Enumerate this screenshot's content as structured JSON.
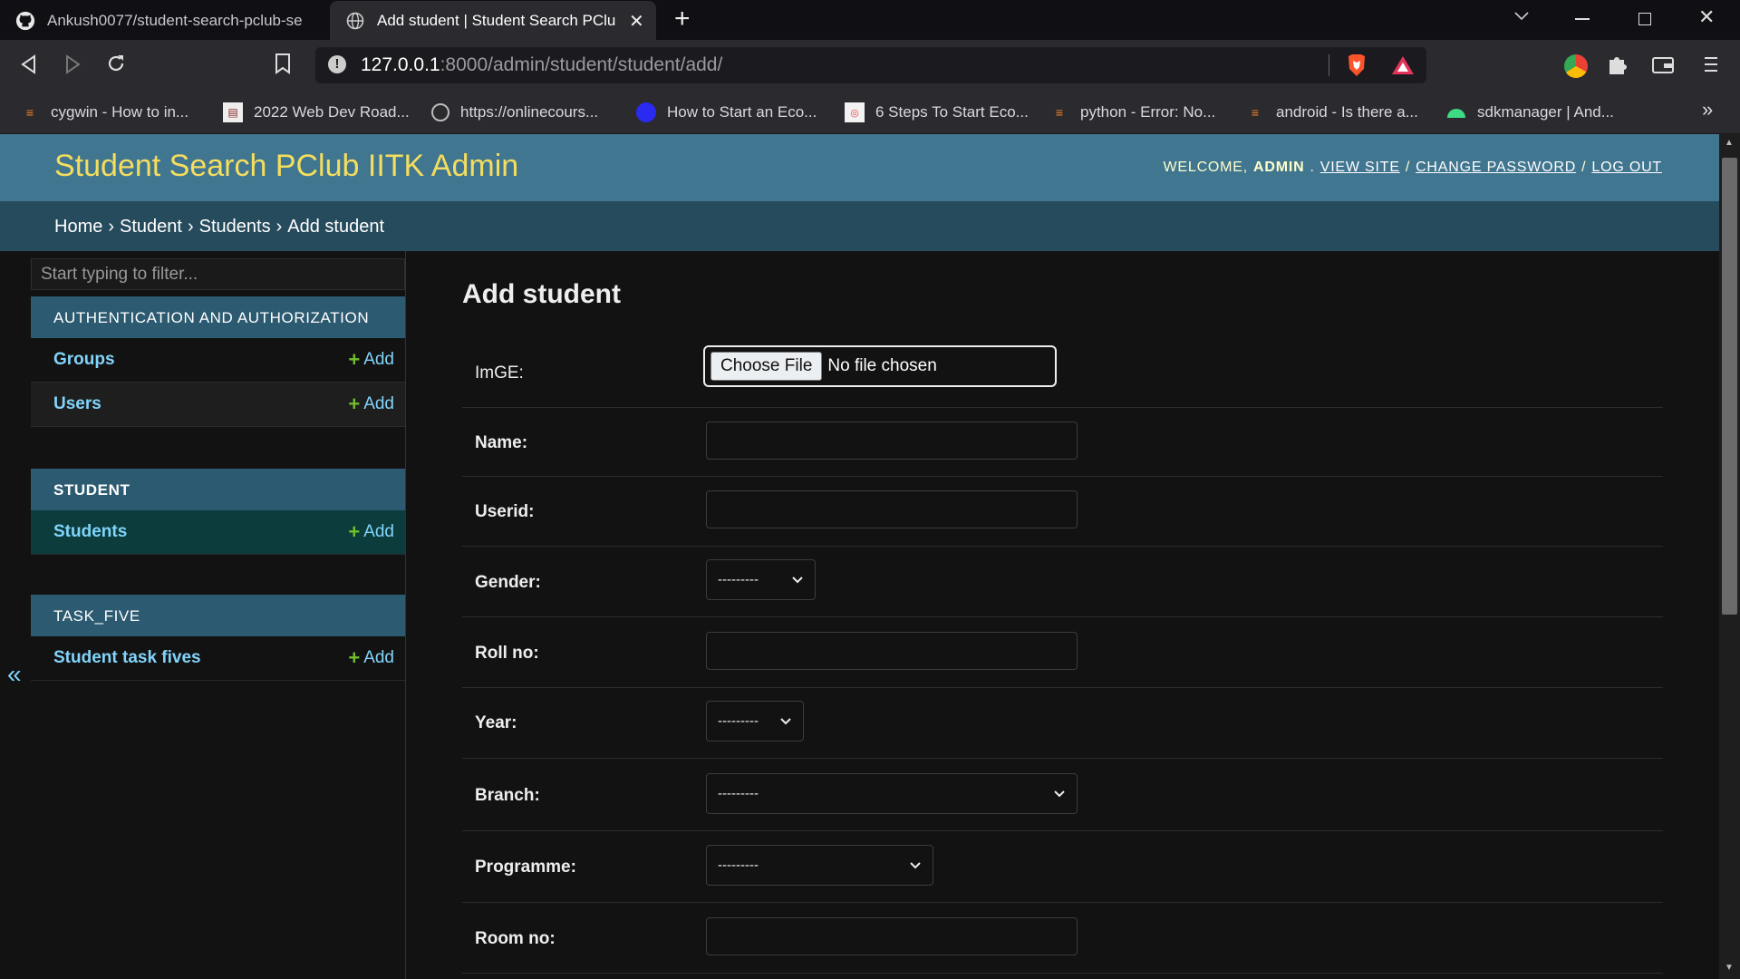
{
  "browser": {
    "tabs": [
      {
        "title": "Ankush0077/student-search-pclub-se",
        "icon": "github-icon"
      },
      {
        "title": "Add student | Student Search PClu",
        "icon": "globe-icon"
      }
    ],
    "url_host": "127.0.0.1",
    "url_rest": ":8000/admin/student/student/add/",
    "bookmarks": [
      {
        "label": "cygwin - How to in...",
        "icon": "stackoverflow-icon"
      },
      {
        "label": "2022 Web Dev Road...",
        "icon": "document-icon"
      },
      {
        "label": "https://onlinecours...",
        "icon": "globe-icon"
      },
      {
        "label": "How to Start an Eco...",
        "icon": "blue-circle-icon"
      },
      {
        "label": "6 Steps To Start Eco...",
        "icon": "page-icon"
      },
      {
        "label": "python - Error: No...",
        "icon": "stackoverflow-icon"
      },
      {
        "label": "android - Is there a...",
        "icon": "stackoverflow-icon"
      },
      {
        "label": "sdkmanager  |  And...",
        "icon": "android-icon"
      }
    ]
  },
  "header": {
    "brand": "Student Search PClub IITK Admin",
    "welcome": "Welcome,",
    "user": "admin",
    "view_site": "View site",
    "change_password": "Change password",
    "logout": "Log out"
  },
  "breadcrumbs": [
    "Home",
    "Student",
    "Students",
    "Add student"
  ],
  "sidebar": {
    "filter_placeholder": "Start typing to filter...",
    "apps": [
      {
        "caption": "Authentication and Authorization",
        "models": [
          {
            "name": "Groups",
            "add": "Add"
          },
          {
            "name": "Users",
            "add": "Add"
          }
        ]
      },
      {
        "caption": "Student",
        "models": [
          {
            "name": "Students",
            "add": "Add"
          }
        ]
      },
      {
        "caption": "TASK_FIVE",
        "models": [
          {
            "name": "Student task fives",
            "add": "Add"
          }
        ]
      }
    ]
  },
  "form": {
    "title": "Add student",
    "image_label": "ImGE:",
    "file_button": "Choose File",
    "file_status": "No file chosen",
    "fields": [
      {
        "label": "Name:",
        "type": "text"
      },
      {
        "label": "Userid:",
        "type": "text"
      },
      {
        "label": "Gender:",
        "type": "select",
        "value": "---------"
      },
      {
        "label": "Roll no:",
        "type": "text"
      },
      {
        "label": "Year:",
        "type": "select",
        "value": "---------"
      },
      {
        "label": "Branch:",
        "type": "select",
        "value": "---------"
      },
      {
        "label": "Programme:",
        "type": "select",
        "value": "---------"
      },
      {
        "label": "Room no:",
        "type": "text"
      }
    ]
  },
  "colors": {
    "header": "#417690",
    "breadcrumbs": "#264b5d",
    "brand": "#f5dd5d",
    "link": "#81d4fa",
    "add_plus": "#70bf2b"
  }
}
